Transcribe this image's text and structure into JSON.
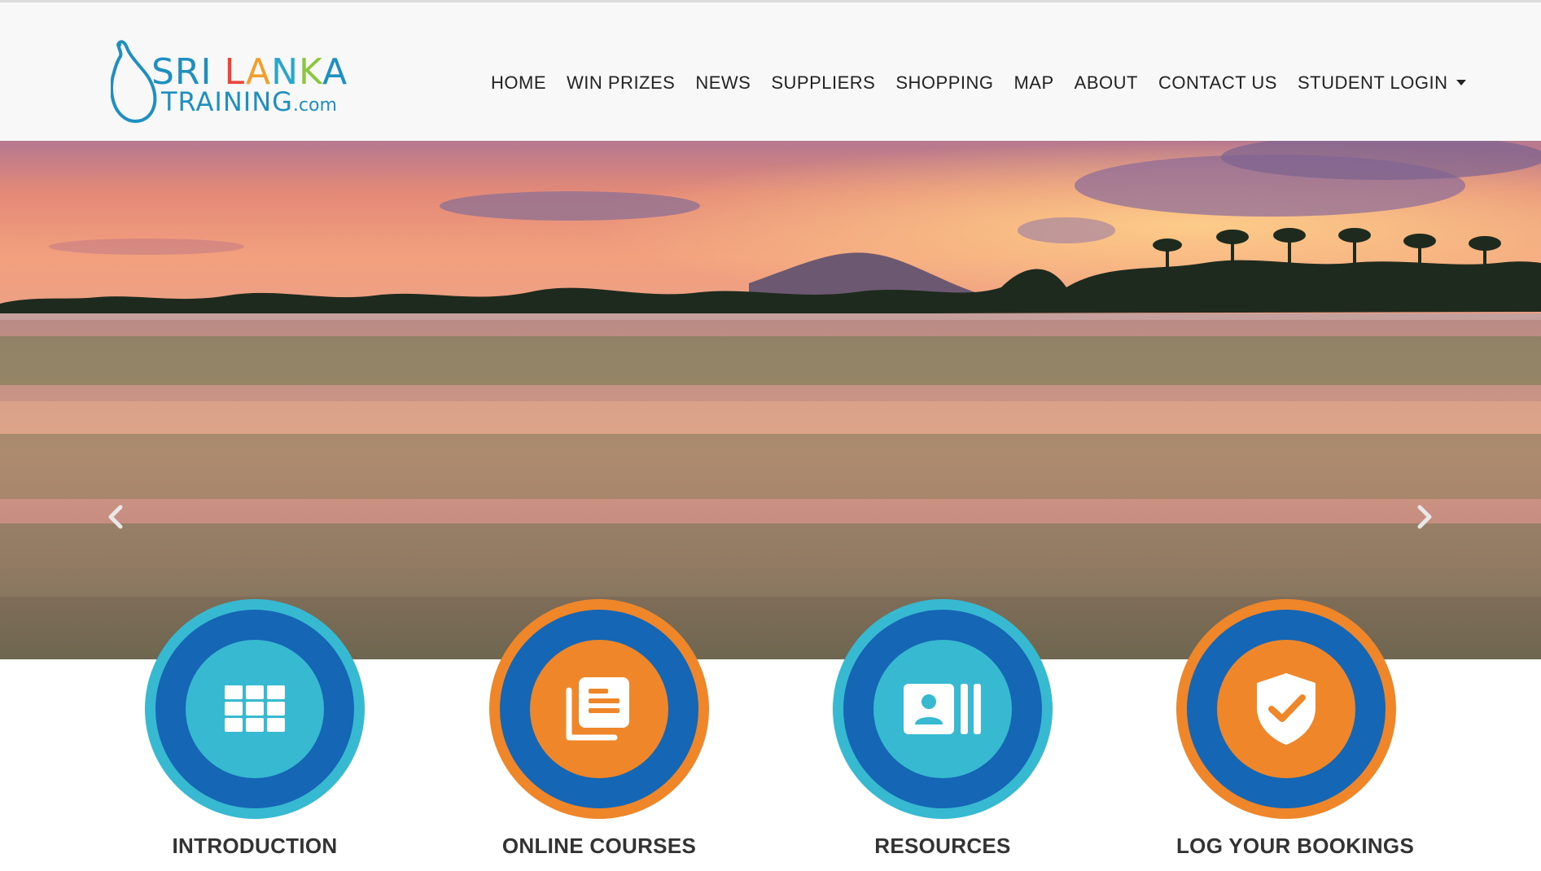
{
  "brand": {
    "logo_line1_parts": [
      "SRI",
      " ",
      "L",
      "A",
      "N",
      "K",
      "A"
    ],
    "logo_line2": "TRAINING",
    "logo_domain": ".com",
    "colors": {
      "sri": "#1f8fc0",
      "l": "#e8463a",
      "a1": "#f0a02a",
      "n": "#2aa6c9",
      "k": "#8cc63f",
      "a2": "#1f8fc0",
      "island": "#1f8fc0"
    }
  },
  "nav": {
    "items": [
      "HOME",
      "WIN PRIZES",
      "NEWS",
      "SUPPLIERS",
      "SHOPPING",
      "MAP",
      "ABOUT",
      "CONTACT US",
      "STUDENT LOGIN"
    ],
    "dropdown_icon": "caret-down-icon"
  },
  "hero": {
    "prev_icon": "chevron-left-icon",
    "next_icon": "chevron-right-icon"
  },
  "features": [
    {
      "label": "INTRODUCTION",
      "icon": "grid-icon",
      "scheme": "teal"
    },
    {
      "label": "ONLINE COURSES",
      "icon": "document-stack-icon",
      "scheme": "orange"
    },
    {
      "label": "RESOURCES",
      "icon": "contact-card-icon",
      "scheme": "teal"
    },
    {
      "label": "LOG YOUR BOOKINGS",
      "icon": "shield-check-icon",
      "scheme": "orange"
    }
  ],
  "colors": {
    "teal": "#36b9d1",
    "orange": "#ef8629",
    "ring_blue": "#1566b4",
    "nav_text": "#222222",
    "label_text": "#333333"
  }
}
